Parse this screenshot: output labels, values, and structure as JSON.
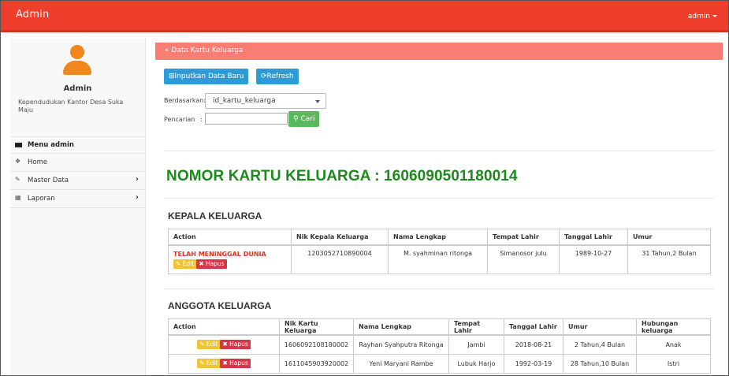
{
  "navbar": {
    "brand": "Admin",
    "user": "admin"
  },
  "sidebar": {
    "avatar_icon": "user-icon",
    "name": "Admin",
    "org": "Kependudukan Kantor Desa Suka Maju",
    "menu_header": "Menu admin",
    "items": [
      {
        "label": "Home",
        "icon": "home-icon",
        "has_chevron": false
      },
      {
        "label": "Master Data",
        "icon": "edit-icon",
        "has_chevron": true
      },
      {
        "label": "Laporan",
        "icon": "calendar-icon",
        "has_chevron": true
      }
    ]
  },
  "panel": {
    "title": "Data Kartu Keluarga",
    "add_button": "Inputkan Data Baru",
    "refresh_button": "Refresh",
    "filter_label": "Berdasarkan:",
    "filter_value": "id_kartu_keluarga",
    "search_label": "Pencarian",
    "search_value": "",
    "search_button": "Cari"
  },
  "kk_title": "NOMOR KARTU KELUARGA : 1606090501180014",
  "kepala": {
    "title": "KEPALA KELUARGA",
    "headers": [
      "Action",
      "Nik Kepala Keluarga",
      "Nama Lengkap",
      "Tempat Lahir",
      "Tanggal Lahir",
      "Umur"
    ],
    "row": {
      "status": "TELAH MENINGGAL DUNIA",
      "edit": "Edit",
      "delete": "Hapus",
      "nik": "1203052710890004",
      "nama": "M. syahminan ritonga",
      "tempat": "Simanosor julu",
      "tanggal": "1989-10-27",
      "umur": "31 Tahun,2 Bulan"
    }
  },
  "anggota": {
    "title": "ANGGOTA KELUARGA",
    "headers": [
      "Action",
      "Nik Kartu Keluarga",
      "Nama Lengkap",
      "Tempat Lahir",
      "Tanggal Lahir",
      "Umur",
      "Hubungan keluarga"
    ],
    "edit": "Edit",
    "delete": "Hapus",
    "rows": [
      {
        "nik": "1606092108180002",
        "nama": "Rayhan Syahputra Ritonga",
        "tempat": "Jambi",
        "tanggal": "2018-08-21",
        "umur": "2 Tahun,4 Bulan",
        "hubungan": "Anak"
      },
      {
        "nik": "1611045903920002",
        "nama": "Yeni Maryani Rambe",
        "tempat": "Lubuk Harjo",
        "tanggal": "1992-03-19",
        "umur": "28 Tahun,10 Bulan",
        "hubungan": "Istri"
      }
    ]
  }
}
